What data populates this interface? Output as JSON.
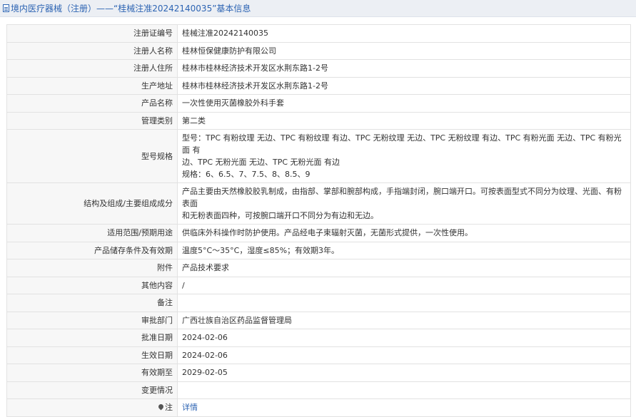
{
  "header": {
    "title": "境内医疗器械（注册）——“桂械注准20242140035”基本信息"
  },
  "rows": [
    {
      "label": "注册证编号",
      "value": "桂械注准20242140035"
    },
    {
      "label": "注册人名称",
      "value": "桂林恒保健康防护有限公司"
    },
    {
      "label": "注册人住所",
      "value": "桂林市桂林经济技术开发区水荆东路1-2号"
    },
    {
      "label": "生产地址",
      "value": "桂林市桂林经济技术开发区水荆东路1-2号"
    },
    {
      "label": "产品名称",
      "value": "一次性使用灭菌橡胶外科手套"
    },
    {
      "label": "管理类别",
      "value": "第二类"
    },
    {
      "label": "型号规格",
      "lines": [
        "型号：TPC 有粉纹理 无边、TPC 有粉纹理 有边、TPC 无粉纹理 无边、TPC 无粉纹理 有边、TPC 有粉光面 无边、TPC 有粉光面 有",
        "边、TPC 无粉光面 无边、TPC 无粉光面 有边",
        "规格：6、6.5、7、7.5、8、8.5、9"
      ]
    },
    {
      "label": "结构及组成/主要组成成分",
      "lines": [
        "产品主要由天然橡胶胶乳制成，由指部、掌部和腕部构成，手指端封闭，腕口端开口。可按表面型式不同分为纹理、光面、有粉表面",
        "和无粉表面四种，可按腕口端开口不同分为有边和无边。"
      ]
    },
    {
      "label": "适用范围/预期用途",
      "value": "供临床外科操作时防护使用。产品经电子束辐射灭菌，无菌形式提供，一次性使用。"
    },
    {
      "label": "产品储存条件及有效期",
      "value": "温度5°C～35°C，湿度≤85%；有效期3年。"
    },
    {
      "label": "附件",
      "value": "产品技术要求"
    },
    {
      "label": "其他内容",
      "value": "/"
    },
    {
      "label": "备注",
      "value": ""
    },
    {
      "label": "审批部门",
      "value": "广西壮族自治区药品监督管理局"
    },
    {
      "label": "批准日期",
      "value": "2024-02-06"
    },
    {
      "label": "生效日期",
      "value": "2024-02-06"
    },
    {
      "label": "有效期至",
      "value": "2029-02-05"
    },
    {
      "label": "变更情况",
      "value": ""
    },
    {
      "label": "注",
      "value": "详情"
    }
  ]
}
